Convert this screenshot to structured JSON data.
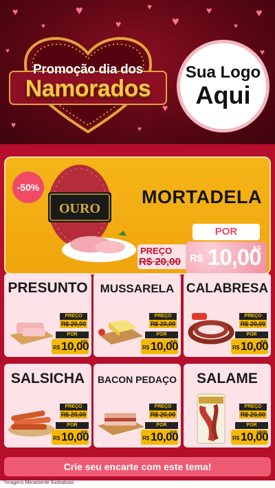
{
  "header": {
    "promo_line1": "Promoção dia dos",
    "promo_line2": "Namorados",
    "logo_line1": "Sua Logo",
    "logo_line2": "Aqui"
  },
  "featured": {
    "discount_badge": "-50%",
    "title": "MORTADELA",
    "preco_label": "PREÇO",
    "old_price": "R$ 20,00",
    "por_label": "POR",
    "currency": "R$",
    "price": "10,00",
    "unit": "KG",
    "package_brand": "OURO"
  },
  "products": [
    {
      "name": "PRESUNTO",
      "preco_label": "PREÇO",
      "old_price": "R$ 20,00",
      "por_label": "POR",
      "currency": "R$",
      "price": "10,00",
      "unit": "KG"
    },
    {
      "name": "MUSSARELA",
      "preco_label": "PREÇO",
      "old_price": "R$ 20,00",
      "por_label": "POR",
      "currency": "R$",
      "price": "10,00",
      "unit": "KG"
    },
    {
      "name": "CALABRESA",
      "preco_label": "PREÇO",
      "old_price": "R$ 20,00",
      "por_label": "POR",
      "currency": "R$",
      "price": "10,00",
      "unit": "KG"
    },
    {
      "name": "SALSICHA",
      "preco_label": "PREÇO",
      "old_price": "R$ 20,00",
      "por_label": "POR",
      "currency": "R$",
      "price": "10,00",
      "unit": "KG"
    },
    {
      "name": "BACON PEDAÇO",
      "preco_label": "PREÇO",
      "old_price": "R$ 20,00",
      "por_label": "POR",
      "currency": "R$",
      "price": "10,00",
      "unit": "KG"
    },
    {
      "name": "SALAME",
      "preco_label": "PREÇO",
      "old_price": "R$ 20,00",
      "por_label": "POR",
      "currency": "R$",
      "price": "10,00",
      "unit": "UNID"
    }
  ],
  "cta": {
    "label": "Crie seu encarte com este tema!"
  },
  "footer": {
    "note": "*Imagens Meramente Ilustrativas"
  },
  "colors": {
    "background_red": "#b50f2b",
    "feature_yellow": "#f5b518",
    "card_pink": "#fde3e8",
    "price_yellow": "#f5b800",
    "gold": "#f6c64a"
  }
}
